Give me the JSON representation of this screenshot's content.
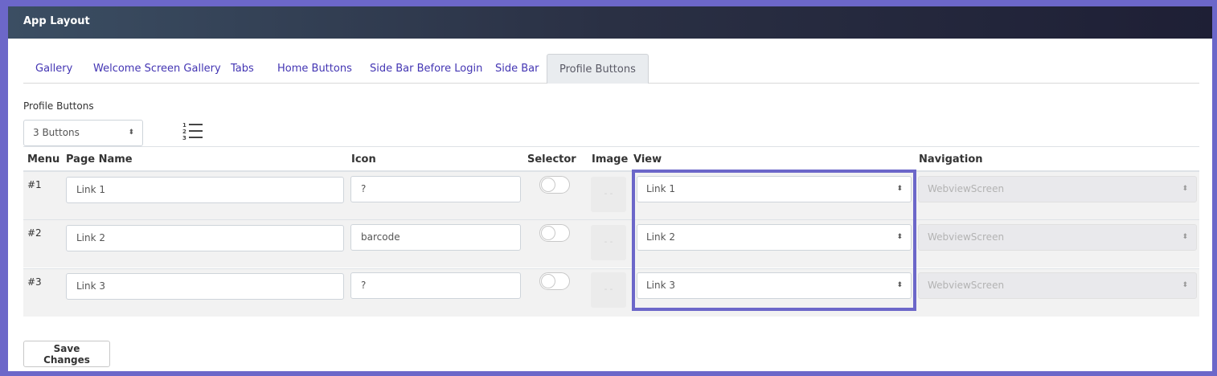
{
  "header": {
    "title": "App Layout"
  },
  "tabs": [
    {
      "label": "Gallery"
    },
    {
      "label": "Welcome Screen Gallery"
    },
    {
      "label": "Tabs"
    },
    {
      "label": "Home Buttons"
    },
    {
      "label": "Side Bar Before Login"
    },
    {
      "label": "Side Bar"
    },
    {
      "label": "Profile Buttons",
      "active": true
    }
  ],
  "section": {
    "label": "Profile Buttons",
    "button_count": "3 Buttons",
    "reorder_icon": "ordered-list-icon"
  },
  "table": {
    "headers": {
      "menu": "Menu",
      "page_name": "Page Name",
      "icon": "Icon",
      "selector": "Selector",
      "image": "Image",
      "view": "View",
      "navigation": "Navigation"
    },
    "rows": [
      {
        "num": "#1",
        "page_name": "Link 1",
        "icon": "?",
        "selector_on": false,
        "view": "Link 1",
        "navigation": "WebviewScreen"
      },
      {
        "num": "#2",
        "page_name": "Link 2",
        "icon": "barcode",
        "selector_on": false,
        "view": "Link 2",
        "navigation": "WebviewScreen"
      },
      {
        "num": "#3",
        "page_name": "Link 3",
        "icon": "?",
        "selector_on": false,
        "view": "Link 3",
        "navigation": "WebviewScreen"
      }
    ]
  },
  "save_button": {
    "label": "Save Changes"
  },
  "colors": {
    "accent": "#6c67c9",
    "link": "#4335b3",
    "header_dark": "#1e1f35"
  }
}
